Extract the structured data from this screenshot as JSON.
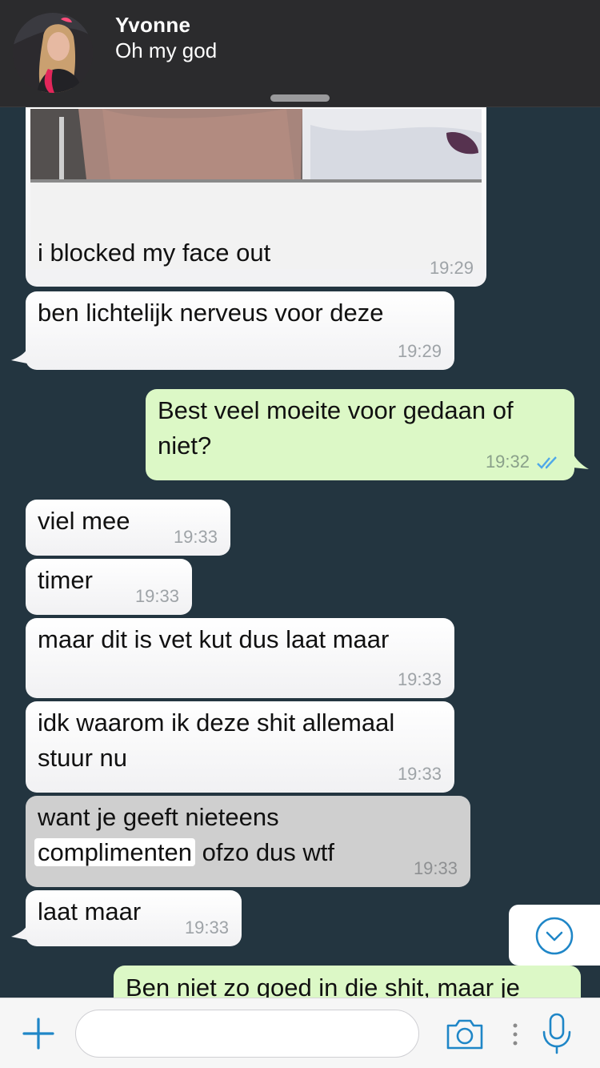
{
  "header": {
    "contact_name": "Yvonne",
    "preview_text": "Oh my god"
  },
  "messages": [
    {
      "direction": "in",
      "text": "i blocked my face out",
      "time": "19:29",
      "has_image": true
    },
    {
      "direction": "in",
      "text": "ben lichtelijk nerveus voor deze",
      "time": "19:29"
    },
    {
      "direction": "out",
      "text": "Best veel moeite voor gedaan of\nniet?",
      "time": "19:32",
      "status": "read"
    },
    {
      "direction": "in",
      "text": "viel mee",
      "time": "19:33"
    },
    {
      "direction": "in",
      "text": "timer",
      "time": "19:33"
    },
    {
      "direction": "in",
      "text": "maar dit is vet kut dus laat maar",
      "time": "19:33"
    },
    {
      "direction": "in",
      "text": "idk waarom ik deze shit allemaal\nstuur nu",
      "time": "19:33"
    },
    {
      "direction": "in",
      "selected": true,
      "text_line1": "want je geeft nieteens",
      "text_highlight": "complimenten",
      "text_rest": "ofzo dus wtf",
      "time": "19:33"
    },
    {
      "direction": "in",
      "text": "laat maar",
      "time": "19:33"
    },
    {
      "direction": "out",
      "text": "Ben niet zo goed in die shit, maar je",
      "partial": true
    }
  ],
  "input": {
    "placeholder": ""
  },
  "icons": {
    "attach": "plus-icon",
    "camera": "camera-icon",
    "more": "more-dots-icon",
    "mic": "microphone-icon",
    "scroll": "chevron-down-icon",
    "read_status": "double-check-icon"
  },
  "colors": {
    "chat_background": "#233540",
    "incoming_bubble": "#ffffff",
    "outgoing_bubble": "#dcf8c6",
    "selected_bubble": "#cfcfcf",
    "accent": "#1f86c7",
    "read_tick": "#4fa8e8"
  }
}
